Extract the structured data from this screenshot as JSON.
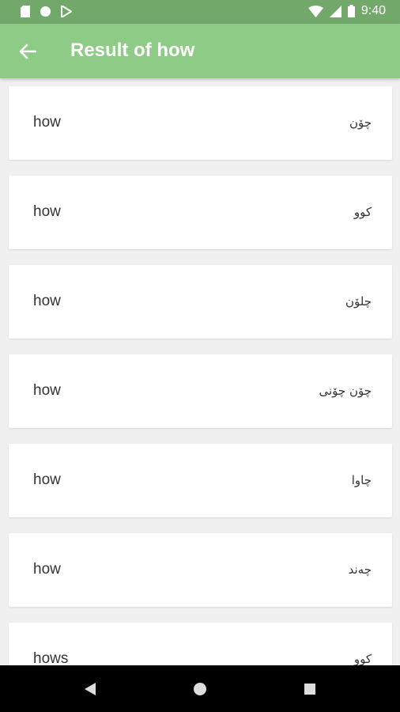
{
  "status_bar": {
    "time": "9:40",
    "left_icons": [
      "sd-card-icon",
      "circle-icon",
      "play-store-icon"
    ],
    "right_icons": [
      "wifi-icon",
      "signal-icon",
      "battery-icon"
    ]
  },
  "app_bar": {
    "title": "Result of how",
    "back_icon": "arrow-left-icon",
    "color": "#8ecb86"
  },
  "results": [
    {
      "word": "how",
      "translation": "چۆن"
    },
    {
      "word": "how",
      "translation": "کوو"
    },
    {
      "word": "how",
      "translation": "چلۆن"
    },
    {
      "word": "how",
      "translation": "چۆن چۆنی"
    },
    {
      "word": "how",
      "translation": "چاوا"
    },
    {
      "word": "how",
      "translation": "چەند"
    },
    {
      "word": "hows",
      "translation": "کوو"
    }
  ],
  "nav_bar": {
    "buttons": [
      "back-triangle-icon",
      "home-circle-icon",
      "recents-square-icon"
    ]
  }
}
